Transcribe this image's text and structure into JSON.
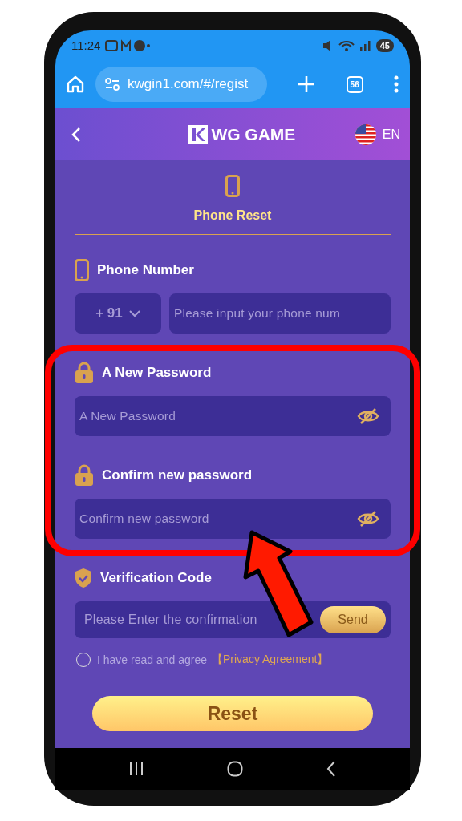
{
  "status_bar": {
    "time": "11:24",
    "battery": "45"
  },
  "browser": {
    "url": "kwgin1.com/#/regist",
    "tab_count": "56"
  },
  "header": {
    "logo": "WG GAME",
    "language": "EN"
  },
  "tab": {
    "label": "Phone Reset",
    "selected": true
  },
  "fields": [
    {
      "kind": "phone",
      "label": "Phone Number",
      "country_code": "+ 91",
      "placeholder": "Please input your phone num"
    },
    {
      "kind": "password",
      "label": "A New Password",
      "placeholder": "A New Password"
    },
    {
      "kind": "password",
      "label": "Confirm new password",
      "placeholder": "Confirm new password"
    },
    {
      "kind": "code",
      "label": "Verification Code",
      "placeholder": "Please Enter the confirmation",
      "button": "Send"
    }
  ],
  "agreement": {
    "text": "I have read and agree",
    "link": "【Privacy Agreement】",
    "checked": false
  },
  "submit": "Reset"
}
